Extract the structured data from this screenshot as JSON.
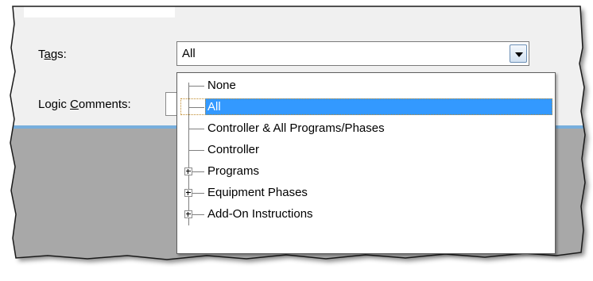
{
  "form": {
    "tags_label_pre": "T",
    "tags_label_ul": "a",
    "tags_label_post": "gs:",
    "comments_label_pre": "Logic ",
    "comments_label_ul": "C",
    "comments_label_post": "omments:"
  },
  "tags_combo": {
    "value": "All",
    "icon": "chevron-down-icon"
  },
  "tree": {
    "items": [
      {
        "label": "None",
        "expandable": false,
        "selected": false
      },
      {
        "label": "All",
        "expandable": false,
        "selected": true
      },
      {
        "label": "Controller & All Programs/Phases",
        "expandable": false,
        "selected": false
      },
      {
        "label": "Controller",
        "expandable": false,
        "selected": false
      },
      {
        "label": "Programs",
        "expandable": true,
        "selected": false
      },
      {
        "label": "Equipment Phases",
        "expandable": true,
        "selected": false
      },
      {
        "label": "Add-On Instructions",
        "expandable": true,
        "selected": false
      }
    ]
  },
  "colors": {
    "dialog_bg": "#f0f0f0",
    "tab_strip": "#e8edf3",
    "separator_blue": "#77aedc",
    "lower_gray": "#a8a8a8",
    "selection": "#3399ff"
  }
}
